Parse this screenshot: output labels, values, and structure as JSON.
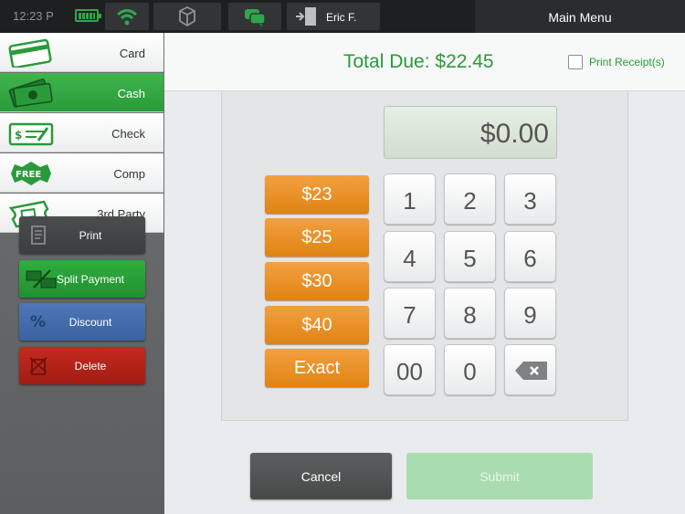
{
  "statusbar": {
    "time": "12:23 P"
  },
  "topbar": {
    "user_name": "Eric F.",
    "main_menu": "Main Menu"
  },
  "sidebar": {
    "tabs": [
      {
        "label": "Card",
        "icon": "credit-card-icon"
      },
      {
        "label": "Cash",
        "icon": "cash-bills-icon"
      },
      {
        "label": "Check",
        "icon": "check-icon"
      },
      {
        "label": "Comp",
        "icon": "free-badge-icon",
        "badge_text": "FREE"
      },
      {
        "label": "3rd Party",
        "icon": "ticket-icon"
      }
    ],
    "actions": [
      {
        "label": "Print",
        "icon": "receipt-icon"
      },
      {
        "label": "Split Payment",
        "icon": "split-payment-icon"
      },
      {
        "label": "Discount",
        "icon": "percent-icon"
      },
      {
        "label": "Delete",
        "icon": "delete-icon"
      }
    ]
  },
  "header": {
    "total_due": "Total Due: $22.45",
    "print_receipt": "Print Receipt(s)"
  },
  "payment": {
    "amount": "$0.00",
    "quick_amounts": [
      "$23",
      "$25",
      "$30",
      "$40",
      "Exact"
    ],
    "keys": [
      "1",
      "2",
      "3",
      "4",
      "5",
      "6",
      "7",
      "8",
      "9",
      "00",
      "0"
    ]
  },
  "footer": {
    "cancel": "Cancel",
    "submit": "Submit"
  },
  "colors": {
    "accent_green": "#2a9a3a",
    "orange": "#e08313",
    "dark": "#1e1f20"
  }
}
